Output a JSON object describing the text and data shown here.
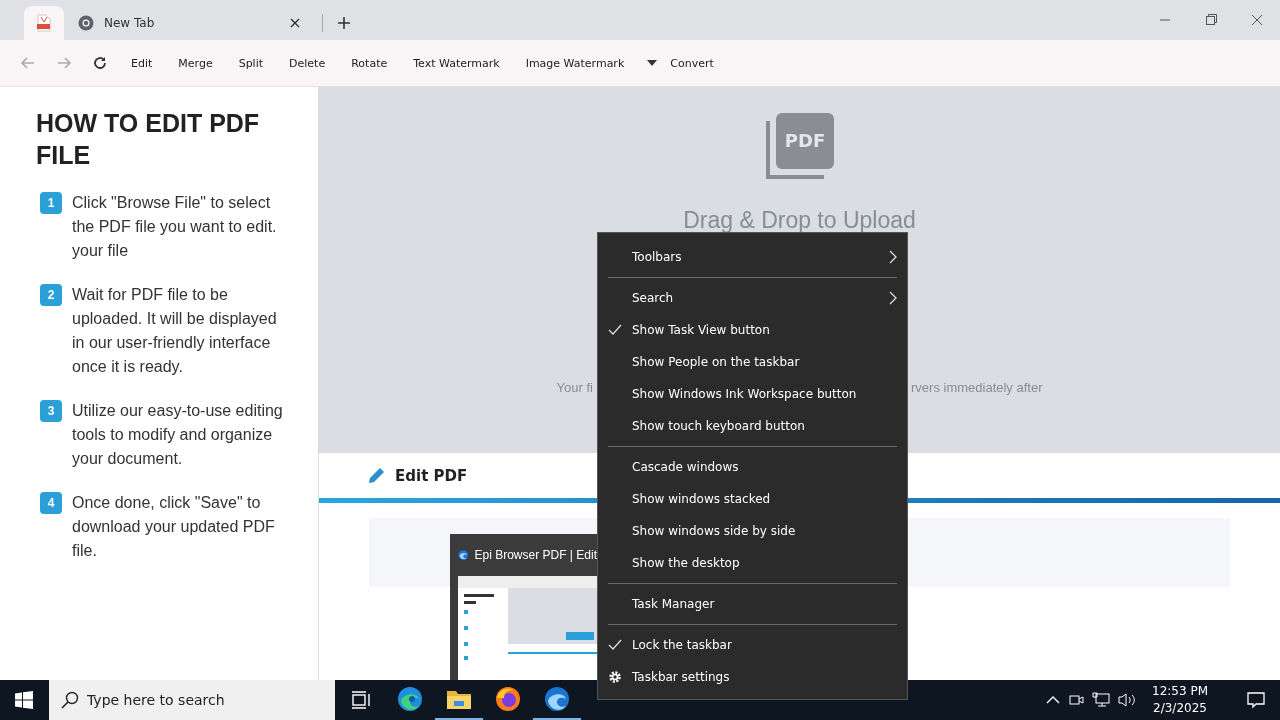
{
  "browser": {
    "tabs": [
      {
        "kind": "pdf",
        "selected": true
      },
      {
        "kind": "chrome",
        "title": "New Tab",
        "selected": false
      }
    ]
  },
  "toolbar": {
    "items": [
      "Edit",
      "Merge",
      "Split",
      "Delete",
      "Rotate",
      "Text Watermark",
      "Image Watermark"
    ],
    "convert": "Convert"
  },
  "guide": {
    "title": "HOW TO EDIT PDF FILE",
    "steps": [
      {
        "number": "1",
        "text": "Click \"Browse File\" to select the PDF file you want to edit. your file"
      },
      {
        "number": "2",
        "text": "Wait for PDF file to be uploaded. It will be displayed in our user-friendly interface once it is ready."
      },
      {
        "number": "3",
        "text": "Utilize our easy-to-use editing tools to modify and organize your document."
      },
      {
        "number": "4",
        "text": "Once done, click \"Save\" to download your updated PDF file."
      }
    ]
  },
  "upload": {
    "icon_label": "PDF",
    "heading": "Drag & Drop to Upload",
    "note_left": "Your fi",
    "note_right": "rvers immediately after"
  },
  "editor": {
    "title": "Edit PDF"
  },
  "preview": {
    "title": "Epi Browser PDF | Edit"
  },
  "context_menu": {
    "sections": [
      {
        "items": [
          {
            "kind": "submenu",
            "label": "Toolbars",
            "checked": false
          }
        ]
      },
      {
        "items": [
          {
            "kind": "submenu",
            "label": "Search",
            "checked": false
          },
          {
            "kind": "item",
            "label": "Show Task View button",
            "checked": true
          },
          {
            "kind": "item",
            "label": "Show People on the taskbar",
            "checked": false
          },
          {
            "kind": "item",
            "label": "Show Windows Ink Workspace button",
            "checked": false
          },
          {
            "kind": "item",
            "label": "Show touch keyboard button",
            "checked": false
          }
        ]
      },
      {
        "items": [
          {
            "kind": "item",
            "label": "Cascade windows",
            "checked": false
          },
          {
            "kind": "item",
            "label": "Show windows stacked",
            "checked": false
          },
          {
            "kind": "item",
            "label": "Show windows side by side",
            "checked": false
          },
          {
            "kind": "item",
            "label": "Show the desktop",
            "checked": false
          }
        ]
      },
      {
        "items": [
          {
            "kind": "item",
            "label": "Task Manager",
            "checked": false
          }
        ]
      },
      {
        "items": [
          {
            "kind": "item",
            "label": "Lock the taskbar",
            "checked": true
          },
          {
            "kind": "settings",
            "label": "Taskbar settings",
            "checked": false
          }
        ]
      }
    ]
  },
  "taskbar": {
    "search_placeholder": "Type here to search",
    "apps": [
      {
        "kind": "edge",
        "running": false
      },
      {
        "kind": "explorer",
        "running": true
      },
      {
        "kind": "firefox",
        "running": false
      },
      {
        "kind": "edge-dev",
        "running": true
      }
    ],
    "time": "12:53 PM",
    "date": "2/3/2025"
  }
}
